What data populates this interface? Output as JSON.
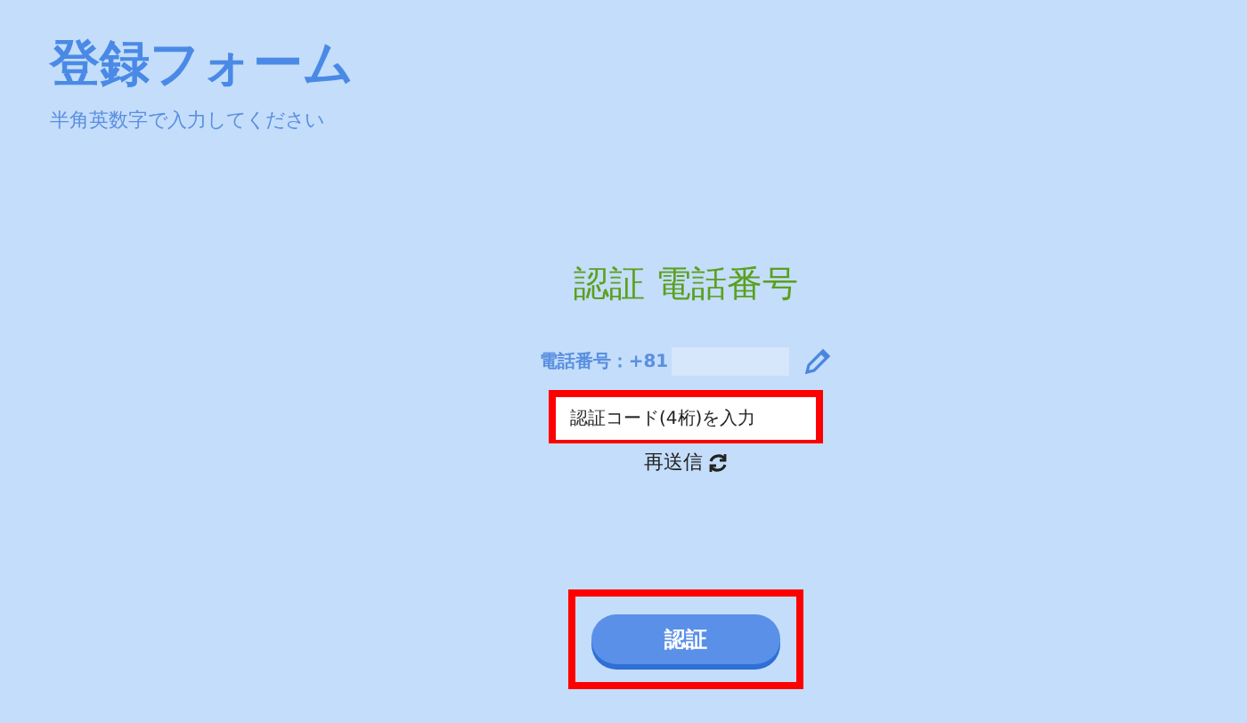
{
  "header": {
    "title": "登録フォーム",
    "subtitle": "半角英数字で入力してください"
  },
  "form": {
    "heading": "認証 電話番号",
    "phone_label": "電話番号：+81",
    "code_field": {
      "placeholder": "認証コード(4桁)を入力"
    },
    "resend": "再送信",
    "submit": "認証"
  }
}
